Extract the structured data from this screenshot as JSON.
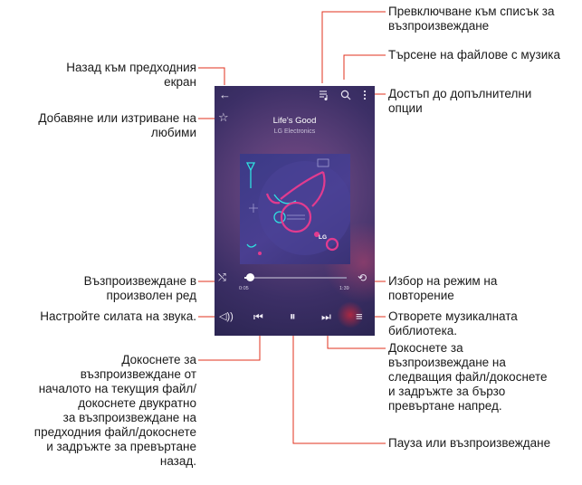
{
  "player": {
    "title": "Life's Good",
    "artist": "LG Electronics",
    "elapsed": "0:05",
    "duration": "1:39",
    "progress_fraction": 0.05,
    "album_logo": "LG"
  },
  "icons": {
    "back": "arrow-left-icon",
    "playlist": "playlist-icon",
    "search": "search-icon",
    "more": "more-options-icon",
    "favorite": "star-icon",
    "shuffle": "shuffle-icon",
    "repeat": "repeat-icon",
    "volume": "volume-icon",
    "previous": "skip-previous-icon",
    "pause": "pause-icon",
    "next": "skip-next-icon",
    "library": "library-icon"
  },
  "colors": {
    "leader_line": "#e0301e",
    "screen_bg": "#4a3a72",
    "album_accent": "#e23b8f",
    "album_cyan": "#2fe0e0"
  },
  "annotations": {
    "playlist": [
      "Превключване към списък за",
      "възпроизвеждане"
    ],
    "search": [
      "Търсене на файлове с музика"
    ],
    "back": [
      "Назад към предходния",
      "екран"
    ],
    "more": [
      "Достъп до допълнителни",
      "опции"
    ],
    "favorite": [
      "Добавяне или изтриване на",
      "любими"
    ],
    "shuffle": [
      "Възпроизвеждане в",
      "произволен ред"
    ],
    "repeat": [
      "Избор на режим на",
      "повторение"
    ],
    "volume": [
      "Настройте силата на звука."
    ],
    "library": [
      "Отворете музикалната",
      "библиотека."
    ],
    "previous": [
      "Докоснете за",
      "възпроизвеждане от",
      "началото на текущия файл/",
      "докоснете двукратно",
      "за възпроизвеждане на",
      "предходния файл/докоснете",
      "и задръжте за превъртане",
      "назад."
    ],
    "next": [
      "Докоснете за",
      "възпроизвеждане на",
      "следващия файл/докоснете",
      "и задръжте за бързо",
      "превъртане напред."
    ],
    "pause": [
      "Пауза или възпроизвеждане"
    ]
  }
}
